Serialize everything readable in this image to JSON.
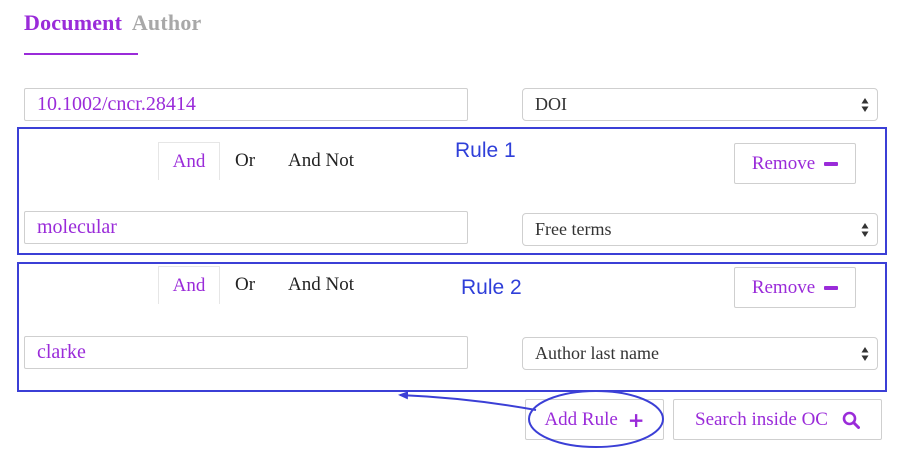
{
  "tabs": {
    "document": "Document",
    "author": "Author"
  },
  "main_query": {
    "value": "10.1002/cncr.28414",
    "field": "DOI"
  },
  "rules": [
    {
      "annotation": "Rule 1",
      "operators": [
        "And",
        "Or",
        "And Not"
      ],
      "selected_operator": "And",
      "remove_label": "Remove",
      "value": "molecular",
      "field": "Free terms"
    },
    {
      "annotation": "Rule 2",
      "operators": [
        "And",
        "Or",
        "And Not"
      ],
      "selected_operator": "And",
      "remove_label": "Remove",
      "value": "clarke",
      "field": "Author last name"
    }
  ],
  "actions": {
    "add_rule": "Add Rule",
    "search": "Search inside OC"
  },
  "icons": {
    "remove": "minus-icon",
    "add": "plus-icon",
    "search": "search-icon",
    "select": "updown-arrows-icon"
  },
  "colors": {
    "accent": "#9a2bd9",
    "inactive_tab": "#a8a8a8",
    "annotation": "#3b3fd6",
    "border": "#cfcfcf"
  }
}
